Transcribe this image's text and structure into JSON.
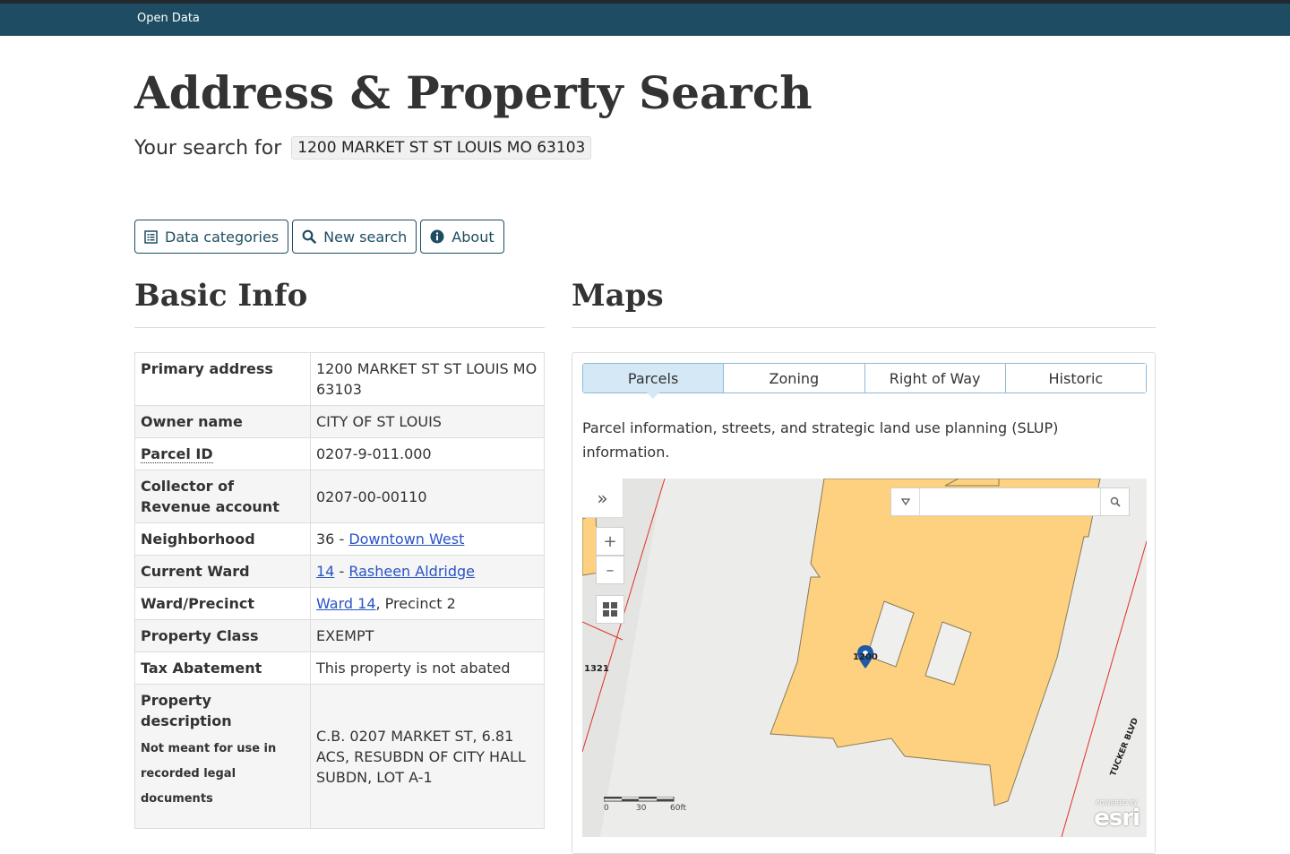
{
  "topbar": {
    "link": "Open Data"
  },
  "page": {
    "title": "Address & Property Search",
    "search_prefix": "Your search for",
    "search_query": "1200 MARKET ST ST LOUIS MO 63103"
  },
  "buttons": {
    "data_categories": "Data categories",
    "new_search": "New search",
    "about": "About"
  },
  "basic_info": {
    "heading": "Basic Info",
    "primary_address_label": "Primary address",
    "primary_address": "1200 MARKET ST ST LOUIS MO 63103",
    "owner_label": "Owner name",
    "owner": "CITY OF ST LOUIS",
    "parcel_label": "Parcel ID",
    "parcel": "0207-9-011.000",
    "collector_label": "Collector of Revenue account",
    "collector": "0207-00-00110",
    "neighborhood_label": "Neighborhood",
    "neighborhood_num": "36 - ",
    "neighborhood_link": "Downtown West",
    "ward_label": "Current Ward",
    "ward_num": "14",
    "ward_sep": " - ",
    "ward_alder": "Rasheen Aldridge",
    "precinct_label": "Ward/Precinct",
    "precinct_link": "Ward 14",
    "precinct_rest": ", Precinct 2",
    "class_label": "Property Class",
    "class": "EXEMPT",
    "abatement_label": "Tax Abatement",
    "abatement": "This property is not abated",
    "description_label": "Property description",
    "description_note": "Not meant for use in recorded legal documents",
    "description": "C.B. 0207 MARKET ST, 6.81 ACS, RESUBDN OF CITY HALL SUBDN, LOT A-1"
  },
  "maps": {
    "heading": "Maps",
    "tabs": [
      "Parcels",
      "Zoning",
      "Right of Way",
      "Historic"
    ],
    "active_tab": "Parcels",
    "description": "Parcel information, streets, and strategic land use planning (SLUP) information.",
    "map": {
      "parcel_label_left": "1321",
      "parcel_label_center": "1200",
      "street_label": "TUCKER BLVD",
      "scale_labels": [
        "0",
        "30",
        "60ft"
      ],
      "attribution_small": "POWERED BY",
      "attribution": "esri",
      "zoom_in": "+",
      "zoom_out": "–",
      "colors": {
        "parcel_fill": "#fdd17f",
        "parcel_stroke": "#8a7a5a",
        "boundary": "#e0302a",
        "marker": "#1f5aa6"
      }
    }
  }
}
